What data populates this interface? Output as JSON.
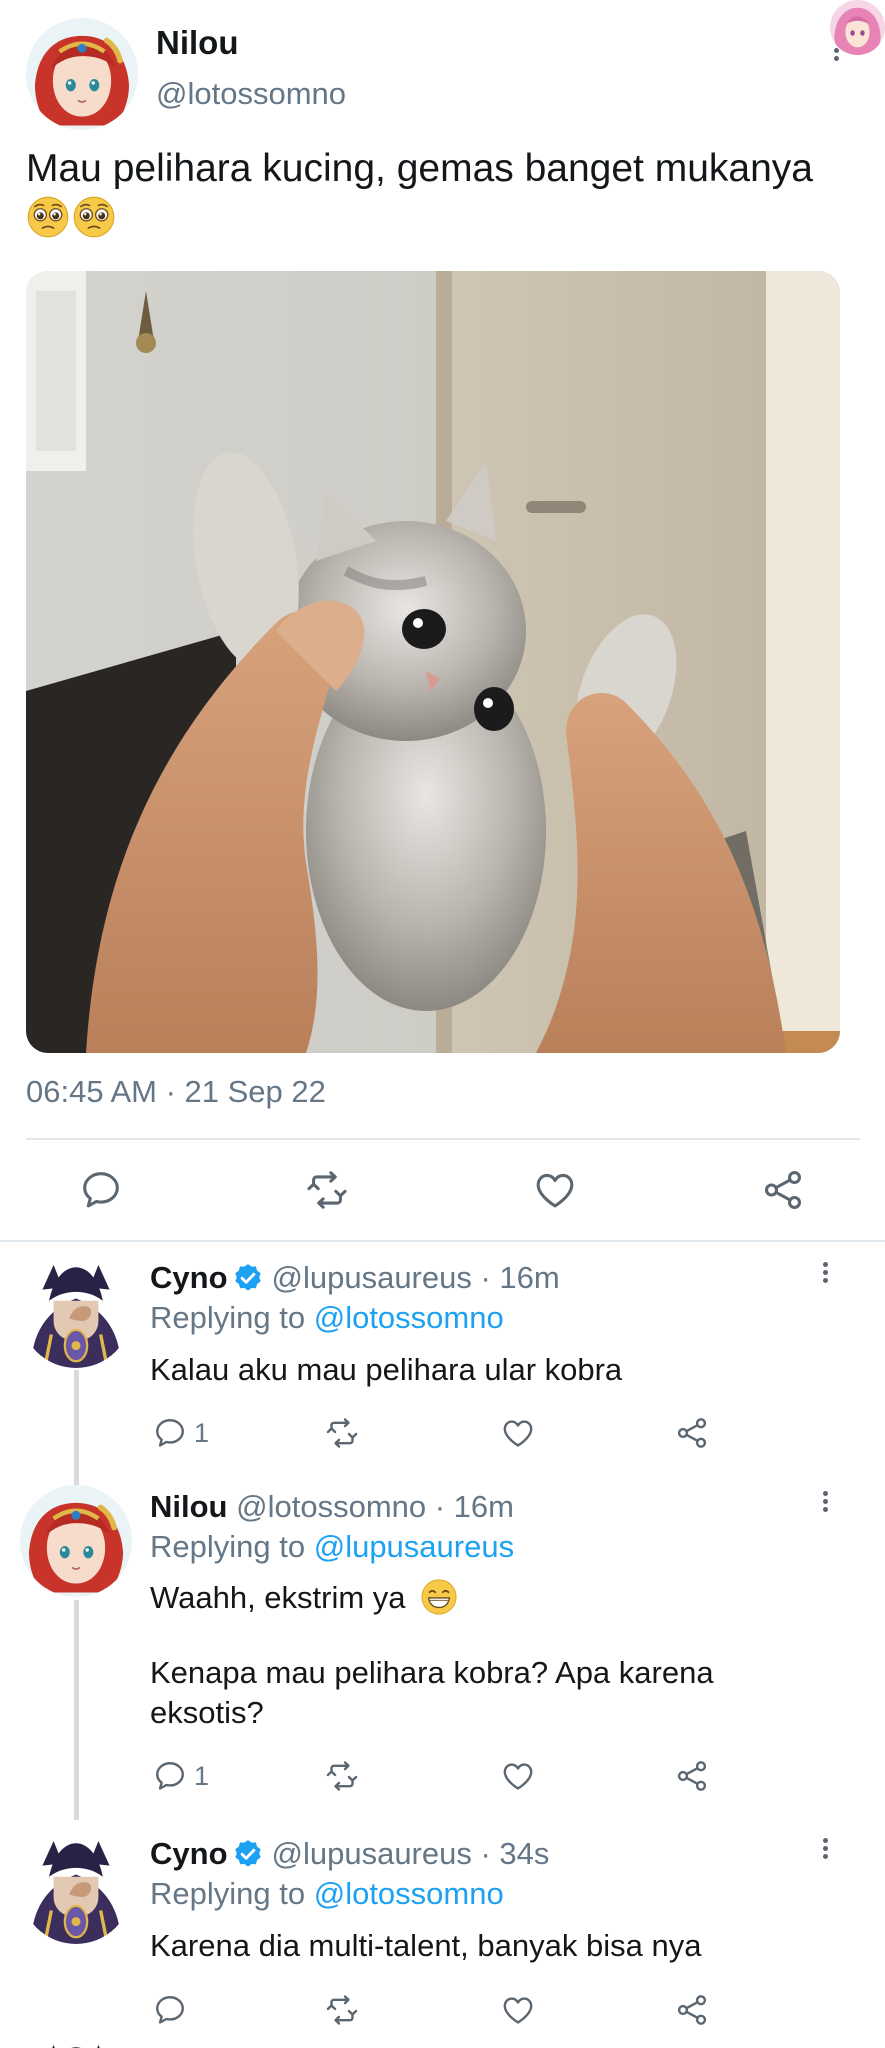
{
  "main_tweet": {
    "author_name": "Nilou",
    "author_handle": "@lotossomno",
    "text": "Mau pelihara kucing, gemas banget mukanya",
    "emoji": "pleading-face-emoji",
    "timestamp": "06:45 AM · 21 Sep 22",
    "actions": [
      "reply-icon",
      "retweet-icon",
      "like-icon",
      "share-icon"
    ]
  },
  "replies": [
    {
      "author_name": "Cyno",
      "verified": true,
      "author_handle": "@lupusaureus",
      "time": "· 16m",
      "replying_label": "Replying to",
      "replying_to": "@lotossomno",
      "text": "Kalau aku mau pelihara ular kobra",
      "reply_count": "1"
    },
    {
      "author_name": "Nilou",
      "verified": false,
      "author_handle": "@lotossomno",
      "time": "· 16m",
      "replying_label": "Replying to",
      "replying_to": "@lupusaureus",
      "text_line1": "Waahh, ekstrim ya",
      "text_line2": "Kenapa mau pelihara kobra? Apa karena eksotis?",
      "reply_count": "1"
    },
    {
      "author_name": "Cyno",
      "verified": true,
      "author_handle": "@lupusaureus",
      "time": "· 34s",
      "replying_label": "Replying to",
      "replying_to": "@lotossomno",
      "text": "Karena dia multi-talent, banyak bisa nya",
      "reply_count": ""
    }
  ],
  "colors": {
    "text": "#14171a",
    "secondary": "#657786",
    "link": "#1da1f2",
    "divider": "#e1e8ed",
    "icon": "#5b6670"
  }
}
